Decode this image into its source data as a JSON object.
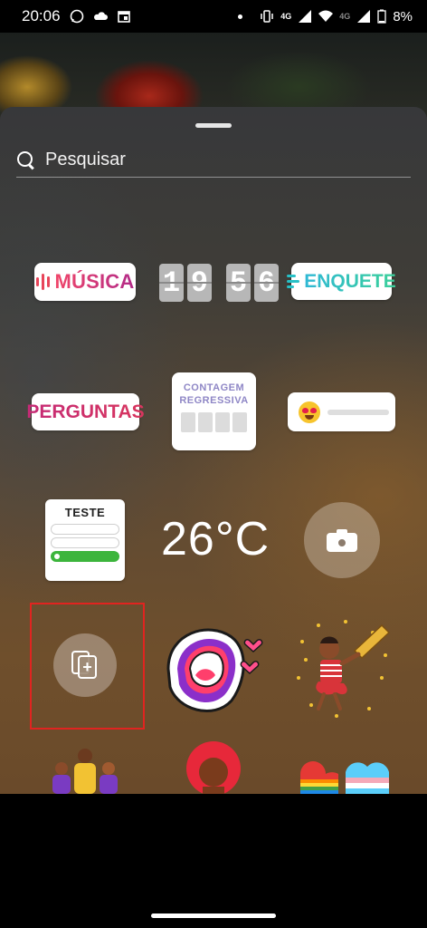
{
  "status_bar": {
    "time": "20:06",
    "network_left": "4G",
    "network_right": "4G",
    "battery": "8%"
  },
  "search": {
    "placeholder": "Pesquisar"
  },
  "stickers": {
    "music_label": "MÚSICA",
    "clock_digits": [
      "1",
      "9",
      "5",
      "6"
    ],
    "poll_label": "ENQUETE",
    "questions_label": "PERGUNTAS",
    "countdown_line1": "CONTAGEM",
    "countdown_line2": "REGRESSIVA",
    "quiz_title": "TESTE",
    "temperature": "26°C"
  },
  "colors": {
    "highlight_border": "#e02420",
    "music_gradient": [
      "#f0466a",
      "#b32b88"
    ],
    "poll_gradient": [
      "#2fb8d5",
      "#3bd09a"
    ],
    "quiz_correct": "#3cb53c"
  },
  "icons": [
    "whatsapp-icon",
    "cloud-icon",
    "calendar-icon",
    "vibrate-icon",
    "wifi-icon",
    "signal-icon",
    "battery-icon",
    "search-icon",
    "camera-icon",
    "gallery-add-icon"
  ]
}
